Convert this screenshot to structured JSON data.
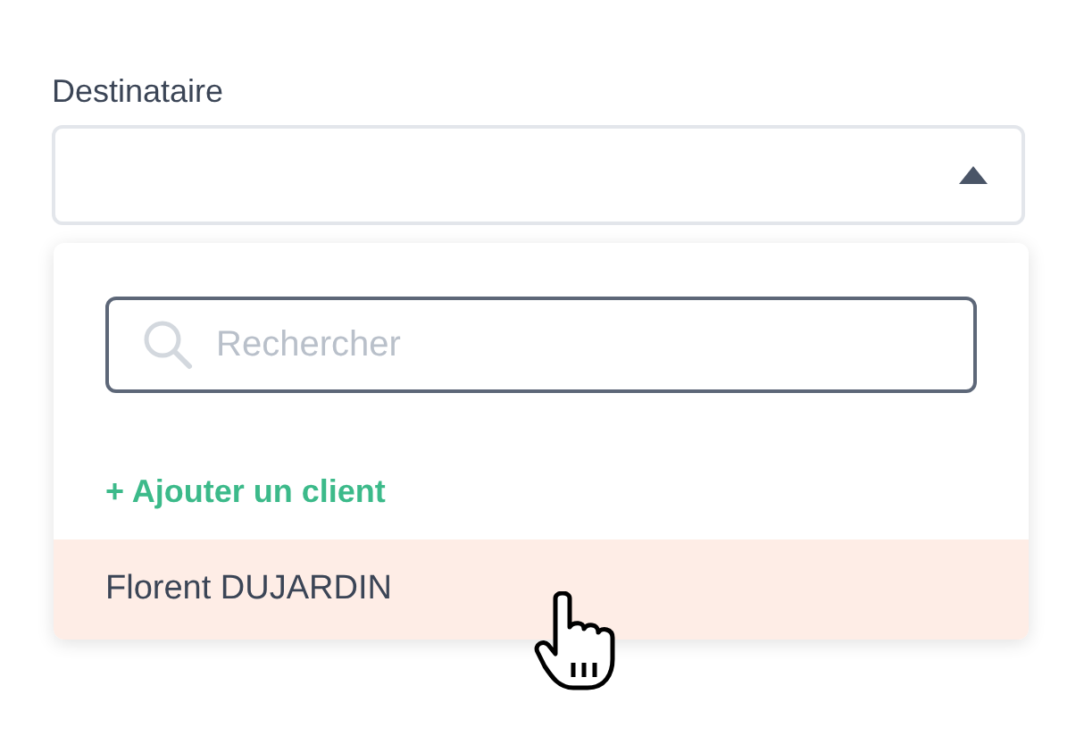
{
  "field": {
    "label": "Destinataire",
    "expanded": true
  },
  "dropdown": {
    "search": {
      "placeholder": "Rechercher"
    },
    "add_action": "+ Ajouter un client",
    "options": [
      {
        "label": "Florent DUJARDIN",
        "selected": true
      }
    ]
  }
}
